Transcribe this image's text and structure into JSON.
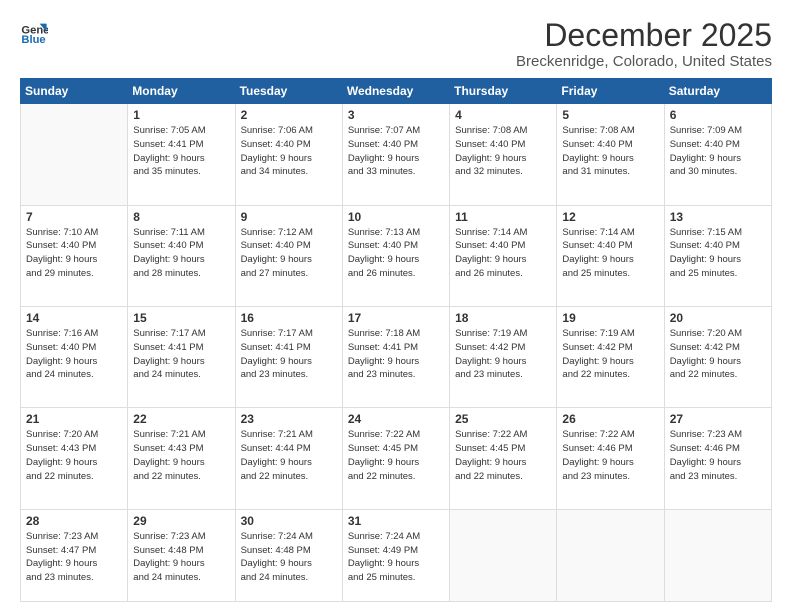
{
  "logo": {
    "line1": "General",
    "line2": "Blue"
  },
  "title": "December 2025",
  "location": "Breckenridge, Colorado, United States",
  "days_of_week": [
    "Sunday",
    "Monday",
    "Tuesday",
    "Wednesday",
    "Thursday",
    "Friday",
    "Saturday"
  ],
  "weeks": [
    [
      {
        "day": "",
        "info": ""
      },
      {
        "day": "1",
        "info": "Sunrise: 7:05 AM\nSunset: 4:41 PM\nDaylight: 9 hours\nand 35 minutes."
      },
      {
        "day": "2",
        "info": "Sunrise: 7:06 AM\nSunset: 4:40 PM\nDaylight: 9 hours\nand 34 minutes."
      },
      {
        "day": "3",
        "info": "Sunrise: 7:07 AM\nSunset: 4:40 PM\nDaylight: 9 hours\nand 33 minutes."
      },
      {
        "day": "4",
        "info": "Sunrise: 7:08 AM\nSunset: 4:40 PM\nDaylight: 9 hours\nand 32 minutes."
      },
      {
        "day": "5",
        "info": "Sunrise: 7:08 AM\nSunset: 4:40 PM\nDaylight: 9 hours\nand 31 minutes."
      },
      {
        "day": "6",
        "info": "Sunrise: 7:09 AM\nSunset: 4:40 PM\nDaylight: 9 hours\nand 30 minutes."
      }
    ],
    [
      {
        "day": "7",
        "info": "Sunrise: 7:10 AM\nSunset: 4:40 PM\nDaylight: 9 hours\nand 29 minutes."
      },
      {
        "day": "8",
        "info": "Sunrise: 7:11 AM\nSunset: 4:40 PM\nDaylight: 9 hours\nand 28 minutes."
      },
      {
        "day": "9",
        "info": "Sunrise: 7:12 AM\nSunset: 4:40 PM\nDaylight: 9 hours\nand 27 minutes."
      },
      {
        "day": "10",
        "info": "Sunrise: 7:13 AM\nSunset: 4:40 PM\nDaylight: 9 hours\nand 26 minutes."
      },
      {
        "day": "11",
        "info": "Sunrise: 7:14 AM\nSunset: 4:40 PM\nDaylight: 9 hours\nand 26 minutes."
      },
      {
        "day": "12",
        "info": "Sunrise: 7:14 AM\nSunset: 4:40 PM\nDaylight: 9 hours\nand 25 minutes."
      },
      {
        "day": "13",
        "info": "Sunrise: 7:15 AM\nSunset: 4:40 PM\nDaylight: 9 hours\nand 25 minutes."
      }
    ],
    [
      {
        "day": "14",
        "info": "Sunrise: 7:16 AM\nSunset: 4:40 PM\nDaylight: 9 hours\nand 24 minutes."
      },
      {
        "day": "15",
        "info": "Sunrise: 7:17 AM\nSunset: 4:41 PM\nDaylight: 9 hours\nand 24 minutes."
      },
      {
        "day": "16",
        "info": "Sunrise: 7:17 AM\nSunset: 4:41 PM\nDaylight: 9 hours\nand 23 minutes."
      },
      {
        "day": "17",
        "info": "Sunrise: 7:18 AM\nSunset: 4:41 PM\nDaylight: 9 hours\nand 23 minutes."
      },
      {
        "day": "18",
        "info": "Sunrise: 7:19 AM\nSunset: 4:42 PM\nDaylight: 9 hours\nand 23 minutes."
      },
      {
        "day": "19",
        "info": "Sunrise: 7:19 AM\nSunset: 4:42 PM\nDaylight: 9 hours\nand 22 minutes."
      },
      {
        "day": "20",
        "info": "Sunrise: 7:20 AM\nSunset: 4:42 PM\nDaylight: 9 hours\nand 22 minutes."
      }
    ],
    [
      {
        "day": "21",
        "info": "Sunrise: 7:20 AM\nSunset: 4:43 PM\nDaylight: 9 hours\nand 22 minutes."
      },
      {
        "day": "22",
        "info": "Sunrise: 7:21 AM\nSunset: 4:43 PM\nDaylight: 9 hours\nand 22 minutes."
      },
      {
        "day": "23",
        "info": "Sunrise: 7:21 AM\nSunset: 4:44 PM\nDaylight: 9 hours\nand 22 minutes."
      },
      {
        "day": "24",
        "info": "Sunrise: 7:22 AM\nSunset: 4:45 PM\nDaylight: 9 hours\nand 22 minutes."
      },
      {
        "day": "25",
        "info": "Sunrise: 7:22 AM\nSunset: 4:45 PM\nDaylight: 9 hours\nand 22 minutes."
      },
      {
        "day": "26",
        "info": "Sunrise: 7:22 AM\nSunset: 4:46 PM\nDaylight: 9 hours\nand 23 minutes."
      },
      {
        "day": "27",
        "info": "Sunrise: 7:23 AM\nSunset: 4:46 PM\nDaylight: 9 hours\nand 23 minutes."
      }
    ],
    [
      {
        "day": "28",
        "info": "Sunrise: 7:23 AM\nSunset: 4:47 PM\nDaylight: 9 hours\nand 23 minutes."
      },
      {
        "day": "29",
        "info": "Sunrise: 7:23 AM\nSunset: 4:48 PM\nDaylight: 9 hours\nand 24 minutes."
      },
      {
        "day": "30",
        "info": "Sunrise: 7:24 AM\nSunset: 4:48 PM\nDaylight: 9 hours\nand 24 minutes."
      },
      {
        "day": "31",
        "info": "Sunrise: 7:24 AM\nSunset: 4:49 PM\nDaylight: 9 hours\nand 25 minutes."
      },
      {
        "day": "",
        "info": ""
      },
      {
        "day": "",
        "info": ""
      },
      {
        "day": "",
        "info": ""
      }
    ]
  ]
}
